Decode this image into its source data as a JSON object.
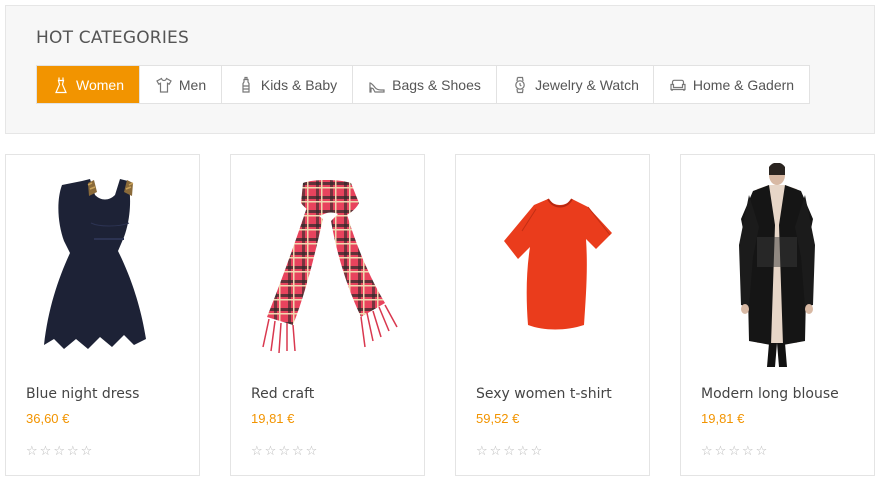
{
  "hot_categories": {
    "title": "HOT CATEGORIES",
    "tabs": [
      {
        "label": "Women",
        "icon": "dress-icon",
        "active": true
      },
      {
        "label": "Men",
        "icon": "tshirt-icon",
        "active": false
      },
      {
        "label": "Kids & Baby",
        "icon": "baby-bottle-icon",
        "active": false
      },
      {
        "label": "Bags & Shoes",
        "icon": "high-heel-icon",
        "active": false
      },
      {
        "label": "Jewelry & Watch",
        "icon": "watch-icon",
        "active": false
      },
      {
        "label": "Home & Gadern",
        "icon": "sofa-icon",
        "active": false
      }
    ]
  },
  "products": [
    {
      "name": "Blue night dress",
      "price": "36,60 €",
      "rating": 0,
      "image": "navy-dress-image"
    },
    {
      "name": "Red craft",
      "price": "19,81 €",
      "rating": 0,
      "image": "plaid-scarf-image"
    },
    {
      "name": "Sexy women t-shirt",
      "price": "59,52 €",
      "rating": 0,
      "image": "red-tshirt-image"
    },
    {
      "name": "Modern long blouse",
      "price": "19,81 €",
      "rating": 0,
      "image": "long-blouse-image"
    }
  ],
  "colors": {
    "accent": "#f29400",
    "star_empty": "#b9b9b9"
  }
}
